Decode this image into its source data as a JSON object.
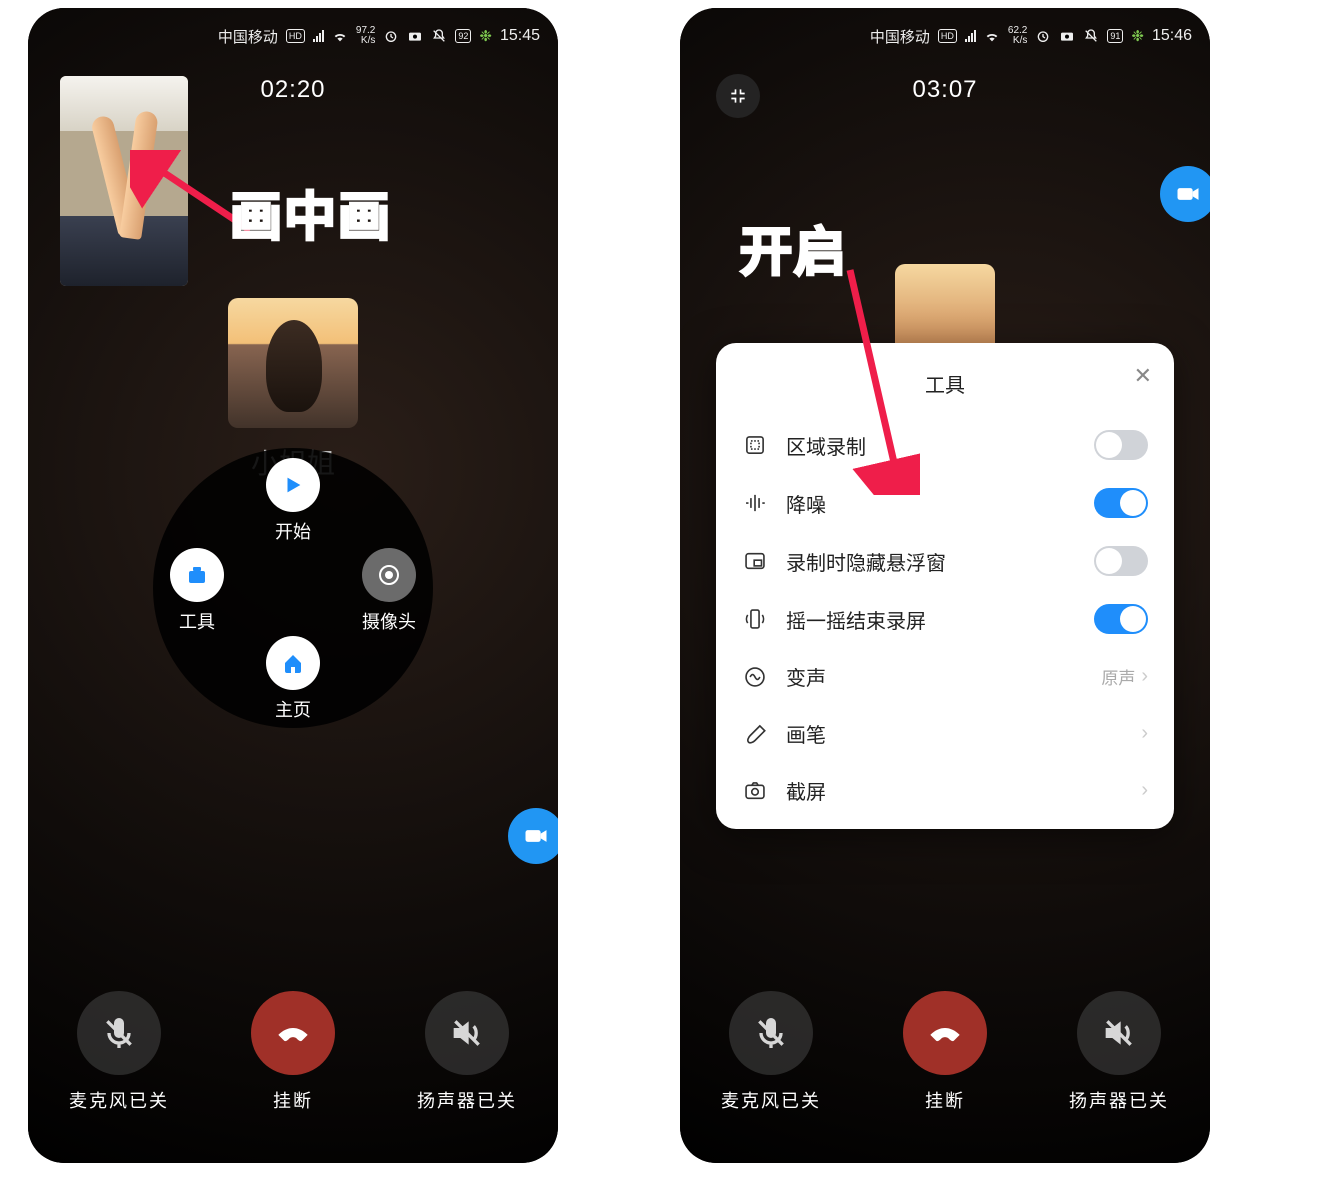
{
  "annotations": {
    "pip_label": "画中画",
    "enable_label": "开启"
  },
  "status": {
    "carrier": "中国移动",
    "hd": "HD",
    "net": "46",
    "ks_left": {
      "top": "97.2",
      "bot": "K/s"
    },
    "ks_right": {
      "top": "62.2",
      "bot": "K/s"
    },
    "batt_left": "92",
    "batt_right": "91",
    "time_left": "15:45",
    "time_right": "15:46"
  },
  "left": {
    "timer": "02:20",
    "contact_name": "小姐姐",
    "wheel": {
      "start": "开始",
      "tools": "工具",
      "camera": "摄像头",
      "home": "主页"
    },
    "callbar": {
      "mic": "麦克风已关",
      "hang": "挂断",
      "speaker": "扬声器已关"
    }
  },
  "right": {
    "timer": "03:07",
    "callbar": {
      "mic": "麦克风已关",
      "hang": "挂断",
      "speaker": "扬声器已关"
    },
    "panel": {
      "title": "工具",
      "rows": {
        "region": {
          "label": "区域录制",
          "on": false
        },
        "noise": {
          "label": "降噪",
          "on": true
        },
        "hide": {
          "label": "录制时隐藏悬浮窗",
          "on": false
        },
        "shake": {
          "label": "摇一摇结束录屏",
          "on": true
        },
        "voice": {
          "label": "变声",
          "value": "原声"
        },
        "pen": {
          "label": "画笔"
        },
        "shot": {
          "label": "截屏"
        }
      }
    }
  }
}
